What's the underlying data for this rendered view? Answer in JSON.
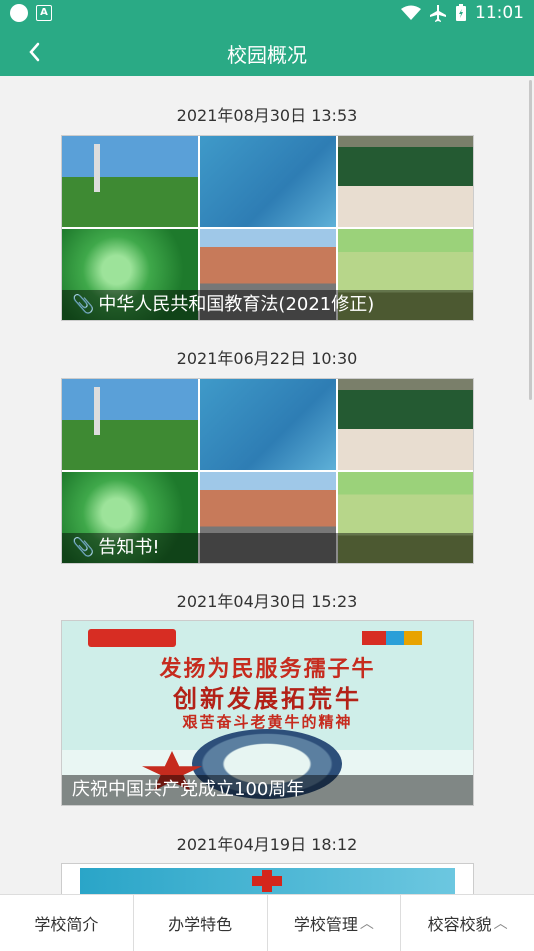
{
  "status_bar": {
    "time": "11:01"
  },
  "app_bar": {
    "title": "校园概况"
  },
  "posts": [
    {
      "date": "2021年08月30日 13:53",
      "caption": "中华人民共和国教育法(2021修正)",
      "has_attachment": true
    },
    {
      "date": "2021年06月22日 10:30",
      "caption": "告知书!",
      "has_attachment": true
    },
    {
      "date": "2021年04月30日 15:23",
      "caption": "庆祝中国共产党成立100周年",
      "has_attachment": false,
      "poster_lines": [
        "发扬为民服务孺子牛",
        "创新发展拓荒牛",
        "艰苦奋斗老黄牛的精神"
      ]
    },
    {
      "date": "2021年04月19日 18:12"
    }
  ],
  "bottom_tabs": [
    {
      "label": "学校简介",
      "has_chevron": false
    },
    {
      "label": "办学特色",
      "has_chevron": false
    },
    {
      "label": "学校管理",
      "has_chevron": true
    },
    {
      "label": "校容校貌",
      "has_chevron": true
    }
  ],
  "icons": {
    "back": "back-arrow-icon",
    "attachment": "paperclip-icon",
    "expand": "chevron-up-icon"
  },
  "colors": {
    "primary": "#2aaa85"
  }
}
